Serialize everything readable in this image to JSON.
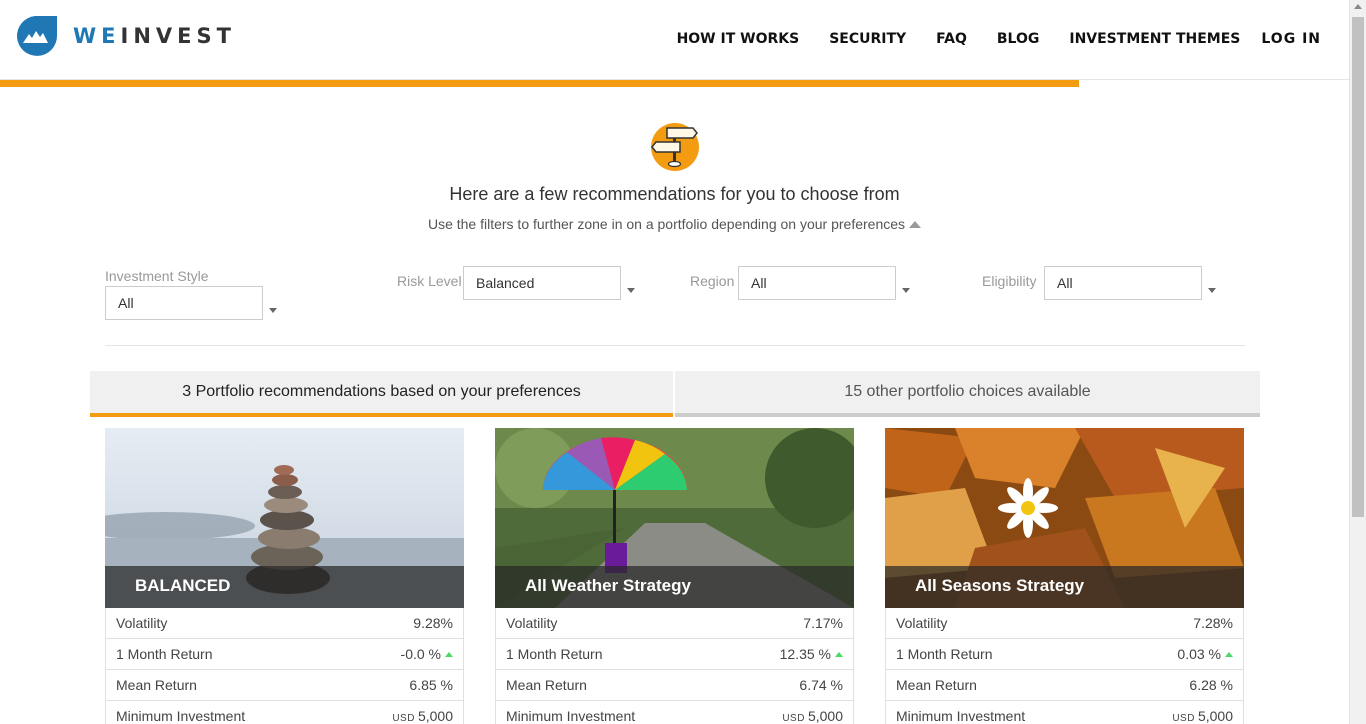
{
  "brand": {
    "prefix": "WE",
    "suffix": "INVEST",
    "accent": "#1f78b4"
  },
  "nav": {
    "items": [
      "HOW IT WORKS",
      "SECURITY",
      "FAQ",
      "BLOG",
      "INVESTMENT THEMES"
    ],
    "login": "LOG IN"
  },
  "progress": {
    "fraction": 0.8,
    "color": "#f39c12"
  },
  "hero": {
    "icon": "signpost-icon",
    "title": "Here are a few recommendations for you to choose from",
    "subtitle": "Use the filters to further zone in on a portfolio depending on your preferences"
  },
  "filters": {
    "style": {
      "label": "Investment Style",
      "value": "All"
    },
    "risk": {
      "label": "Risk Level",
      "value": "Balanced"
    },
    "region": {
      "label": "Region",
      "value": "All"
    },
    "eligibility": {
      "label": "Eligibility",
      "value": "All"
    }
  },
  "tabs": [
    {
      "label": "3 Portfolio recommendations based on your preferences",
      "active": true
    },
    {
      "label": "15 other portfolio choices available",
      "active": false
    }
  ],
  "row_labels": {
    "volatility": "Volatility",
    "month_return": "1 Month Return",
    "mean_return": "Mean Return",
    "min_investment": "Minimum Investment"
  },
  "cards": [
    {
      "name": "BALANCED",
      "volatility": "9.28%",
      "month_return": "-0.0 %",
      "mean_return": "6.85 %",
      "currency": "USD",
      "min_investment": "5,000"
    },
    {
      "name": "All Weather Strategy",
      "volatility": "7.17%",
      "month_return": "12.35 %",
      "mean_return": "6.74 %",
      "currency": "USD",
      "min_investment": "5,000"
    },
    {
      "name": "All Seasons Strategy",
      "volatility": "7.28%",
      "month_return": "0.03 %",
      "mean_return": "6.28 %",
      "currency": "USD",
      "min_investment": "5,000"
    }
  ]
}
